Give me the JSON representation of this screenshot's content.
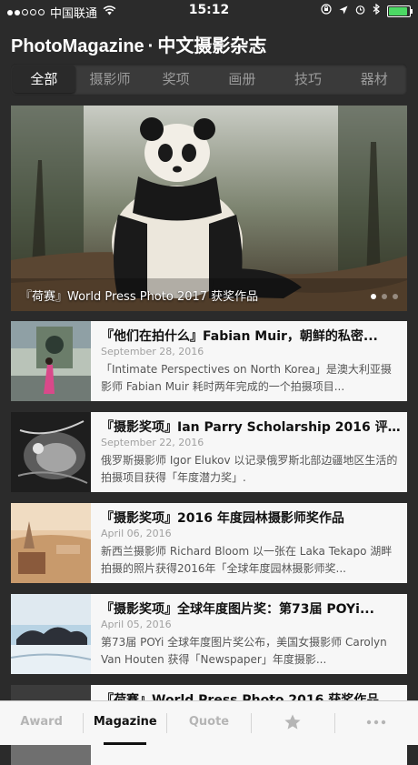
{
  "status": {
    "carrier": "中国联通",
    "time": "15:12"
  },
  "app": {
    "name": "PhotoMagazine",
    "sep": "·",
    "subtitle": "中文摄影杂志"
  },
  "tabs": [
    {
      "label": "全部",
      "active": true
    },
    {
      "label": "摄影师"
    },
    {
      "label": "奖项"
    },
    {
      "label": "画册"
    },
    {
      "label": "技巧"
    },
    {
      "label": "器材"
    }
  ],
  "hero": {
    "caption": "『荷赛』World Press Photo 2017 获奖作品"
  },
  "articles": [
    {
      "title": "『他们在拍什么』Fabian Muir，朝鲜的私密...",
      "date": "September 28, 2016",
      "excerpt": "「Intimate Perspectives on North Korea」是澳大利亚摄影师 Fabian Muir 耗时两年完成的一个拍摄项目..."
    },
    {
      "title": "『摄影奖项』Ian Parry Scholarship 2016 评...",
      "date": "September 22, 2016",
      "excerpt": "俄罗斯摄影师 Igor Elukov 以记录俄罗斯北部边疆地区生活的拍摄项目获得「年度潜力奖」."
    },
    {
      "title": "『摄影奖项』2016 年度园林摄影师奖作品",
      "date": "April 06, 2016",
      "excerpt": "新西兰摄影师 Richard Bloom 以一张在 Laka Tekapo 湖畔拍摄的照片获得2016年「全球年度园林摄影师奖..."
    },
    {
      "title": "『摄影奖项』全球年度图片奖：第73届 POYi...",
      "date": "April 05, 2016",
      "excerpt": "第73届 POYi 全球年度图片奖公布，美国女摄影师 Carolyn Van Houten 获得「Newspaper」年度摄影..."
    },
    {
      "title": "『荷赛』World Press Photo 2016 获奖作品",
      "date": "",
      "excerpt": ""
    }
  ],
  "tabbar": [
    {
      "label": "Award"
    },
    {
      "label": "Magazine",
      "active": true
    },
    {
      "label": "Quote"
    },
    {
      "label": "",
      "icon": "star-icon"
    },
    {
      "label": "",
      "icon": "more-icon"
    }
  ]
}
